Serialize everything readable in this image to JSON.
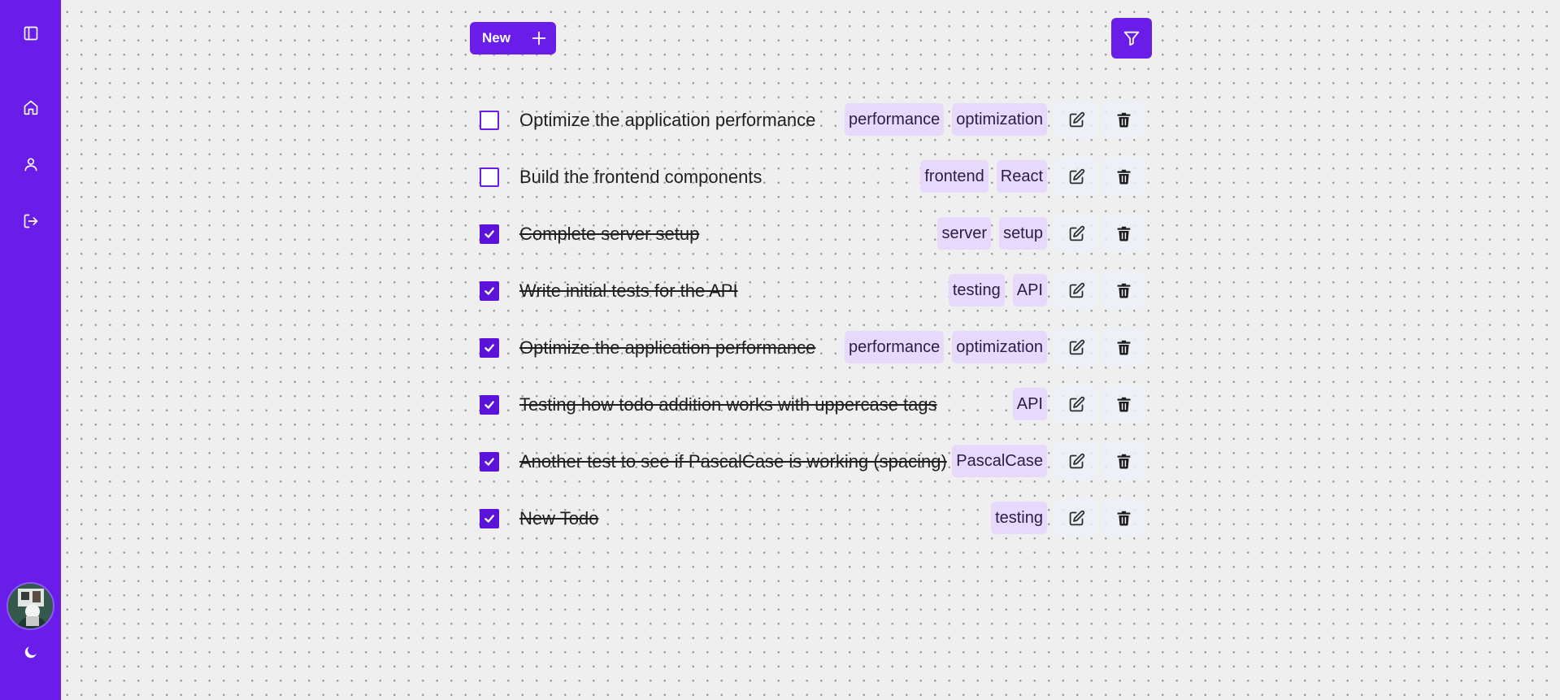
{
  "sidebar": {
    "top_icons": [
      "sidebar-toggle-icon",
      "home-icon",
      "user-icon",
      "logout-icon"
    ],
    "bottom_icons": [
      "avatar",
      "moon-icon"
    ]
  },
  "toolbar": {
    "new_label": "New",
    "new_icon": "plus-icon",
    "filter_icon": "filter-icon"
  },
  "colors": {
    "accent": "#6a1de8",
    "checkbox_checked": "#5b13d9",
    "tag_background": "#e6d9fc",
    "page_background": "#efefef"
  },
  "todos": [
    {
      "text": "Optimize the application performance",
      "done": false,
      "tags": [
        "performance",
        "optimization"
      ]
    },
    {
      "text": "Build the frontend components",
      "done": false,
      "tags": [
        "frontend",
        "React"
      ]
    },
    {
      "text": "Complete server setup",
      "done": true,
      "tags": [
        "server",
        "setup"
      ]
    },
    {
      "text": "Write initial tests for the API",
      "done": true,
      "tags": [
        "testing",
        "API"
      ]
    },
    {
      "text": "Optimize the application performance",
      "done": true,
      "tags": [
        "performance",
        "optimization"
      ]
    },
    {
      "text": "Testing how todo addition works with uppercase tags",
      "done": true,
      "tags": [
        "API"
      ]
    },
    {
      "text": "Another test to see if PascalCase is working (spacing)",
      "done": true,
      "tags": [
        "PascalCase"
      ]
    },
    {
      "text": "New Todo",
      "done": true,
      "tags": [
        "testing"
      ]
    }
  ]
}
